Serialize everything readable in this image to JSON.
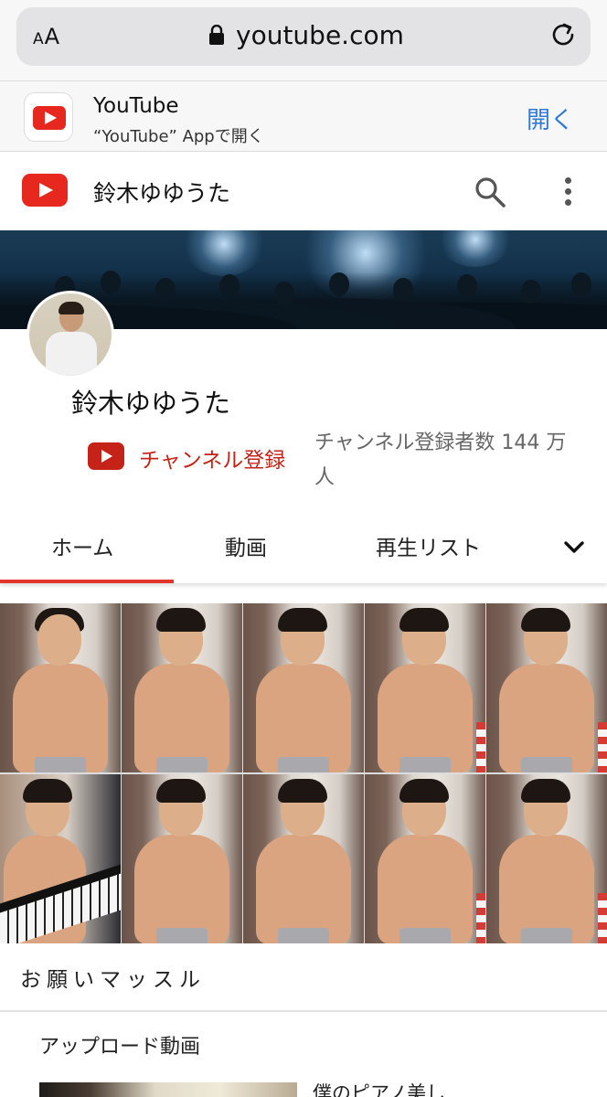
{
  "browser": {
    "text_size_label_small": "A",
    "text_size_label_large": "A",
    "url": "youtube.com"
  },
  "app_banner": {
    "app_name": "YouTube",
    "subtitle": "“YouTube” Appで開く",
    "open_label": "開く"
  },
  "header": {
    "title": "鈴木ゆゆうた"
  },
  "channel": {
    "name": "鈴木ゆゆうた",
    "subscribe_label": "チャンネル登録",
    "subscriber_count": "チャンネル登録者数 144 万人"
  },
  "tabs": [
    {
      "label": "ホーム",
      "active": true
    },
    {
      "label": "動画",
      "active": false
    },
    {
      "label": "再生リスト",
      "active": false
    }
  ],
  "featured_video": {
    "title": "お願いマッスル"
  },
  "uploads": {
    "section_title": "アップロード動画",
    "first_video_title": "僕のピアノ美し"
  },
  "colors": {
    "youtube_red": "#e6281f",
    "subscribe_red": "#c52318",
    "link_blue": "#2f7ad6",
    "tab_underline": "#e3342d"
  }
}
